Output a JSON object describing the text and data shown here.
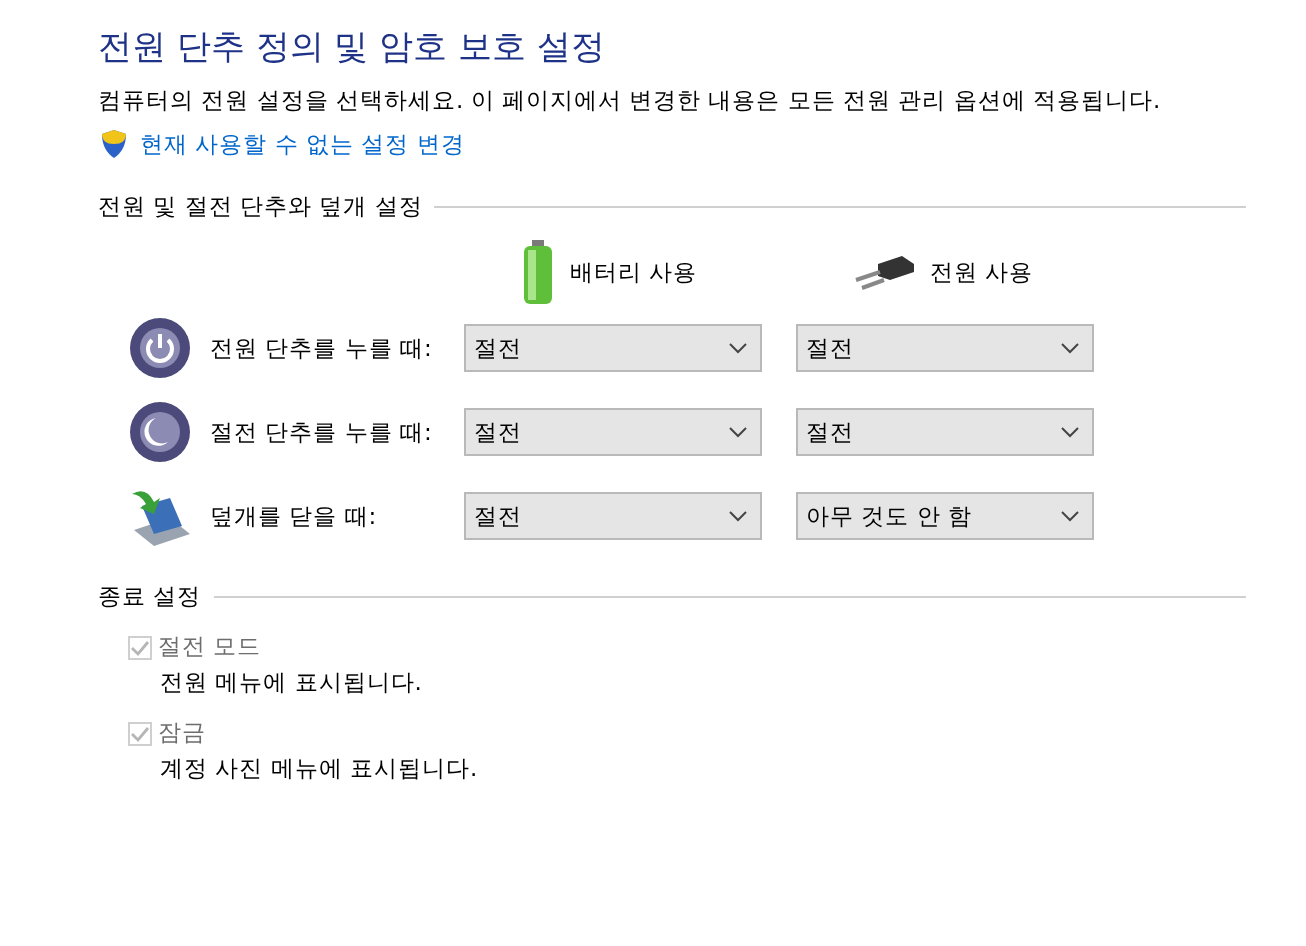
{
  "title": "전원 단추 정의 및 암호 보호 설정",
  "description": "컴퓨터의 전원 설정을 선택하세요. 이 페이지에서 변경한 내용은 모든 전원 관리 옵션에 적용됩니다.",
  "admin_link": "현재 사용할 수 없는 설정 변경",
  "buttons_section": {
    "heading": "전원 및 절전 단추와 덮개 설정",
    "columns": [
      {
        "kind": "battery",
        "label": "배터리 사용"
      },
      {
        "kind": "plug",
        "label": "전원 사용"
      }
    ],
    "rows": [
      {
        "kind": "power",
        "label": "전원 단추를 누를 때:",
        "values": [
          "절전",
          "절전"
        ]
      },
      {
        "kind": "sleep",
        "label": "절전 단추를 누를 때:",
        "values": [
          "절전",
          "절전"
        ]
      },
      {
        "kind": "lid",
        "label": "덮개를 닫을 때:",
        "values": [
          "절전",
          "아무 것도 안 함"
        ]
      }
    ]
  },
  "shutdown_section": {
    "heading": "종료 설정",
    "options": [
      {
        "label": "절전 모드",
        "description": "전원 메뉴에 표시됩니다.",
        "checked": true,
        "disabled": true
      },
      {
        "label": "잠금",
        "description": "계정 사진 메뉴에 표시됩니다.",
        "checked": true,
        "disabled": true
      }
    ]
  }
}
